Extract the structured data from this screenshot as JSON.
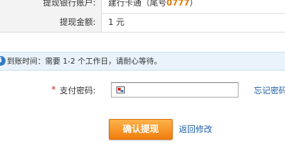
{
  "withdraw_info": {
    "bank_account_label": "提现银行账户:",
    "bank_account_name": "建行卡通（尾号",
    "bank_account_tail": "0777",
    "bank_account_close": "）",
    "amount_label": "提现金额:",
    "amount_value": "1 元"
  },
  "notice": {
    "icon": "info-icon",
    "text": "到账时间：需要 1-2 个工作日，请耐心等待。"
  },
  "password": {
    "required_mark": "*",
    "label": "支付密码:",
    "value": "",
    "keyboard_icon": "keyboard-icon",
    "forgot_link": "忘记密码"
  },
  "actions": {
    "confirm_label": "确认提现",
    "back_label": "返回修改"
  },
  "colors": {
    "accent_orange": "#f07d0d",
    "link_blue": "#1a5fa8",
    "notice_bg": "#eaf3fb",
    "tail_number": "#e07b00"
  }
}
